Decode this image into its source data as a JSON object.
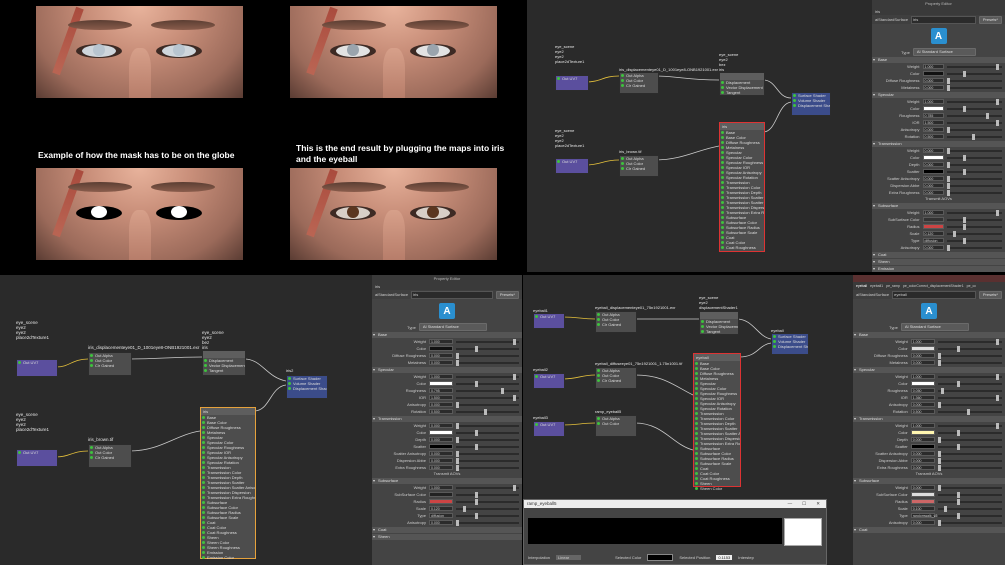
{
  "renders": {
    "caption_left": "Example of how the mask has to be on the globe",
    "caption_right": "This is the end result by plugging the maps into iris and the eyeball"
  },
  "graph_tr": {
    "labels_a": [
      "eye_scene",
      "eye2",
      "eye2",
      "place2dTexture1"
    ],
    "labels_b": [
      "eye_scene",
      "eye2",
      "eye2",
      "place2dTexture1"
    ],
    "labels_c": [
      "eye_scene",
      "eye2",
      "bez",
      "iris"
    ],
    "disp_node": "iris_displacementeye01_D_1001eye8-ONB1921001.exr",
    "iris_brown_node": "iris_brown.tif",
    "out_uv": "Out UV7",
    "out_alpha": "Out Alpha",
    "out_color": "Out Color",
    "clr_gain": "Clr Gained",
    "disp_rows": [
      "Displacement",
      "Vector Displacement",
      "Tangent"
    ],
    "sg_rows": [
      "Surface Shader",
      "Volume Shader",
      "Displacement Shader"
    ],
    "iris_title": "iris",
    "surface_rows": [
      "Base",
      "Base Color",
      "Diffuse Roughness",
      "Metalness",
      "Specular",
      "Specular Color",
      "Specular Roughness",
      "Specular IOR",
      "Specular Anisotropy",
      "Specular Rotation",
      "Transmission",
      "Transmission Color",
      "Transmission Depth",
      "Transmission Scatter",
      "Transmission Scatter Anisotropy",
      "Transmission Dispersion",
      "Transmission Extra Roughness",
      "Subsurface",
      "Subsurface Color",
      "Subsurface Radius",
      "Subsurface Scale",
      "Coat",
      "Coat Color",
      "Coat Roughness",
      "Sheen",
      "Sheen Color",
      "Sheen Roughness",
      "Emission",
      "Emission Color",
      "Opacity",
      "Normal Camera"
    ]
  },
  "pe_right": {
    "window_title": "Property Editor",
    "tab": "iris",
    "shader_label": "aiStandardSurface",
    "shader_name": "iris",
    "presets": "Presets*",
    "type_label": "Type",
    "type_value": "AI Standard Surface",
    "sections": {
      "base": "Base",
      "specular": "Specular",
      "transmission": "Transmission",
      "subsurface": "Subsurface",
      "coat": "Coat",
      "sheen": "Sheen",
      "emission": "Emission"
    },
    "base_rows": [
      [
        "Weight",
        "1.000"
      ],
      [
        "Color",
        ""
      ],
      [
        "Diffuse Roughness",
        "0.000"
      ],
      [
        "Metalness",
        "0.000"
      ]
    ],
    "spec_rows": [
      [
        "Weight",
        "1.000"
      ],
      [
        "Color",
        ""
      ],
      [
        "Roughness",
        "0.785"
      ],
      [
        "IOR",
        "1.500"
      ],
      [
        "Anisotropy",
        "0.000"
      ],
      [
        "Rotation",
        "0.500"
      ]
    ],
    "trans_rows": [
      [
        "Weight",
        "0.000"
      ],
      [
        "Color",
        ""
      ],
      [
        "Depth",
        "0.000"
      ],
      [
        "Scatter",
        ""
      ],
      [
        "Scatter Anisotropy",
        "0.000"
      ],
      [
        "Dispersion Abbe",
        "0.000"
      ],
      [
        "Extra Roughness",
        "0.000"
      ]
    ],
    "transmit_aovs": "Transmit AOVs",
    "sss_rows": [
      [
        "Weight",
        "1.000"
      ],
      [
        "SubSurface Color",
        ""
      ],
      [
        "Radius",
        ""
      ],
      [
        "Scale",
        "0.120"
      ],
      [
        "Type",
        "diffusion"
      ],
      [
        "Anisotropy",
        "0.000"
      ]
    ]
  },
  "pe_bl": {
    "window_title": "Property Editor",
    "tab": "iris",
    "shader_label": "aiStandardSurface",
    "shader_name": "iris",
    "presets": "Presets*",
    "type_label": "Type",
    "type_value": "AI Standard Surface",
    "base_rows": [
      [
        "Weight",
        "1.000"
      ],
      [
        "Color",
        ""
      ],
      [
        "Diffuse Roughness",
        "0.000"
      ],
      [
        "Metalness",
        "0.000"
      ]
    ],
    "spec_rows": [
      [
        "Weight",
        "1.000"
      ],
      [
        "Color",
        ""
      ],
      [
        "Roughness",
        "0.795"
      ],
      [
        "IOR",
        "1.500"
      ],
      [
        "Anisotropy",
        "0.000"
      ],
      [
        "Rotation",
        "0.500"
      ]
    ],
    "trans_rows": [
      [
        "Weight",
        "0.000"
      ],
      [
        "Color",
        ""
      ],
      [
        "Depth",
        "0.000"
      ],
      [
        "Scatter",
        ""
      ],
      [
        "Scatter Anisotropy",
        "0.000"
      ],
      [
        "Dispersion Abbe",
        "0.000"
      ],
      [
        "Extra Roughness",
        "0.000"
      ]
    ],
    "transmit_aovs": "Transmit AOVs",
    "sss_rows": [
      [
        "Weight",
        "1.000"
      ],
      [
        "SubSurface Color",
        ""
      ],
      [
        "Radius",
        ""
      ],
      [
        "Scale",
        "0.120"
      ],
      [
        "Type",
        "diffusion"
      ],
      [
        "Anisotropy",
        "0.000"
      ]
    ],
    "extra": [
      "Coat",
      "Sheen"
    ]
  },
  "pe_br": {
    "tabs": [
      "eyeball",
      "eyeball1",
      "pe_ramp",
      "pe_colorCorrect_displacementShader1",
      "pe_cc"
    ],
    "shader_label": "aiStandardSurface",
    "shader_name": "eyeball",
    "presets": "Presets*",
    "type_label": "Type",
    "type_value": "AI Standard Surface",
    "base_rows": [
      [
        "Weight",
        "1.000"
      ],
      [
        "Color",
        ""
      ],
      [
        "Diffuse Roughness",
        "0.000"
      ],
      [
        "Metalness",
        "0.000"
      ]
    ],
    "spec_rows": [
      [
        "Weight",
        "1.000"
      ],
      [
        "Color",
        ""
      ],
      [
        "Roughness",
        "0.050"
      ],
      [
        "IOR",
        "1.360"
      ],
      [
        "Anisotropy",
        "0.000"
      ],
      [
        "Rotation",
        "0.500"
      ]
    ],
    "trans_rows": [
      [
        "Weight",
        "1.000"
      ],
      [
        "Color",
        ""
      ],
      [
        "Depth",
        "0.000"
      ],
      [
        "Scatter",
        ""
      ],
      [
        "Scatter Anisotropy",
        "0.000"
      ],
      [
        "Dispersion Abbe",
        "0.000"
      ],
      [
        "Extra Roughness",
        "0.000"
      ]
    ],
    "transmit_aovs": "Transmit AOVs",
    "sss_rows": [
      [
        "Weight",
        "0.000"
      ],
      [
        "SubSurface Color",
        ""
      ],
      [
        "Radius",
        ""
      ],
      [
        "Scale",
        "0.100"
      ],
      [
        "Type",
        "randomwalk_v2"
      ],
      [
        "Anisotropy",
        "0.000"
      ]
    ],
    "extra": [
      "Coat"
    ]
  },
  "graph_bl": {
    "labels_a": [
      "eye_scene",
      "eye2",
      "eye2",
      "place2dTexture1"
    ],
    "labels_b": [
      "eye_scene",
      "eye2",
      "eye2",
      "place2dTexture1"
    ],
    "labels_c": [
      "eye_scene",
      "eye2",
      "bez",
      "iris"
    ],
    "disp_node": "iris_displacementeye01_D_1001eye8-ONB1921001.exr",
    "iris_brown_node": "iris_brown.tif",
    "sg": "iris2"
  },
  "graph_br": {
    "n1": "eyeball1",
    "n2": "eyeball2",
    "n3": "eyeball3",
    "disp": "eyeball_displacementeye01_75n1921001.exr",
    "diff": "eyeball_diffuseeye01_75n1921001_1.75n1001.tif",
    "ramp": "ramp_eyeball5",
    "labels": [
      "eye_scene",
      "eye2",
      "displacementShader1"
    ],
    "sg": "eyeball",
    "eyeball_node": "eyeball"
  },
  "ramp_window": {
    "title": "ramp_eyeball5",
    "interpolation_label": "Interpolation",
    "interpolation_value": "Linear",
    "selected_color_label": "Selected Color",
    "selected_position_label": "Selected Position",
    "selected_position_value": "0.1153",
    "selected_extra": "Interstep",
    "controls": [
      "—",
      "☐",
      "✕"
    ]
  },
  "colors": {
    "graph_bg": "#2a2a2a",
    "node": "#4d4d4d",
    "selected": "#e6a23c",
    "error": "#d33333",
    "arnold": "#2a8fcf"
  }
}
